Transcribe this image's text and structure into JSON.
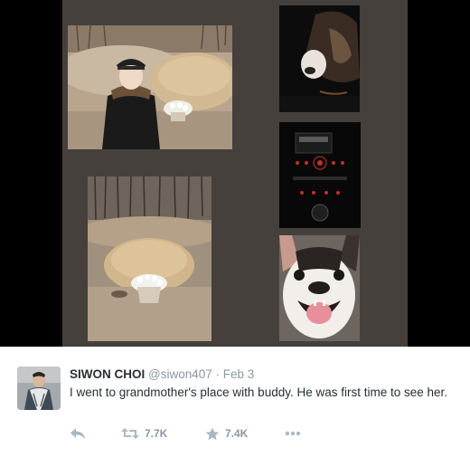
{
  "tweet": {
    "display_name": "SIWON CHOI",
    "username": "@siwon407",
    "separator": "·",
    "timestamp": "Feb 3",
    "text": "I went to grandmother's place with buddy. He was first time to see her.",
    "actions": {
      "reply_icon": "reply-icon",
      "retweet_icon": "retweet-icon",
      "retweet_count": "7.7K",
      "favorite_icon": "star-icon",
      "favorite_count": "7.4K",
      "more_icon": "more-icon"
    }
  },
  "media": {
    "photos": [
      {
        "name": "selfie-at-grave-photo"
      },
      {
        "name": "dog-in-car-photo"
      },
      {
        "name": "car-dashboard-photo"
      },
      {
        "name": "grave-mound-with-flowers-photo"
      },
      {
        "name": "bulldog-closeup-photo"
      }
    ]
  },
  "colors": {
    "collage_background": "#45403c",
    "media_background": "#000000",
    "text_primary": "#292f33",
    "text_secondary": "#8899a6",
    "action_icon": "#aab8c2"
  }
}
